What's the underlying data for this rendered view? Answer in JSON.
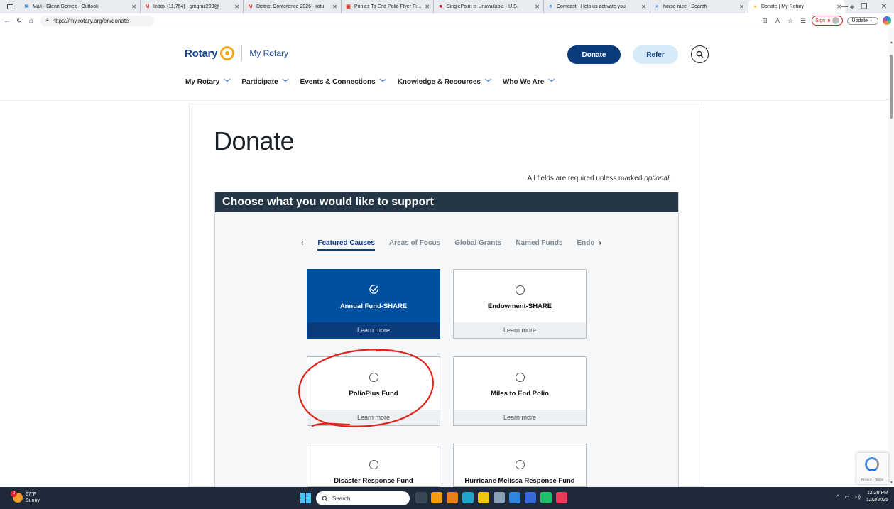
{
  "browser": {
    "tabs": [
      {
        "title": "Mail - Glenn Gomez - Outlook",
        "color": "#0f6cbd",
        "glyph": "✉"
      },
      {
        "title": "Inbox (11,764) - gmgmz209@",
        "color": "#ea4335",
        "glyph": "M"
      },
      {
        "title": "District Conference 2026 - rotu",
        "color": "#ea4335",
        "glyph": "M"
      },
      {
        "title": "Ponies To End Polio Flyer Final",
        "color": "#d93025",
        "glyph": "▣"
      },
      {
        "title": "SinglePoint is Unavailable - U.S.",
        "color": "#c8102e",
        "glyph": "■"
      },
      {
        "title": "Comcast - Help us activate you",
        "color": "#1a73e8",
        "glyph": "e"
      },
      {
        "title": "horse race - Search",
        "color": "#1a73e8",
        "glyph": "⌕"
      },
      {
        "title": "Donate | My Rotary",
        "color": "#f7a81b",
        "glyph": "●"
      }
    ],
    "active_tab_index": 7,
    "url": "https://my.rotary.org/en/donate",
    "sign_in_label": "Sign in",
    "update_label": "Update"
  },
  "site": {
    "logo_word": "Rotary",
    "logo_sub": "My Rotary",
    "donate_button": "Donate",
    "refer_button": "Refer",
    "nav": [
      "My Rotary",
      "Participate",
      "Events & Connections",
      "Knowledge & Resources",
      "Who We Are"
    ]
  },
  "page": {
    "title": "Donate",
    "required_note": "All fields are required unless marked",
    "required_optional": "optional",
    "required_period": ".",
    "support_heading": "Choose what you would like to support",
    "tabs": [
      "Featured Causes",
      "Areas of Focus",
      "Global Grants",
      "Named Funds",
      "Endo"
    ],
    "active_tab": "Featured Causes",
    "options": [
      {
        "name": "Annual Fund-SHARE",
        "learn": "Learn more",
        "selected": true
      },
      {
        "name": "Endowment-SHARE",
        "learn": "Learn more",
        "selected": false
      },
      {
        "name": "PolioPlus Fund",
        "learn": "Learn more",
        "selected": false
      },
      {
        "name": "Miles to End Polio",
        "learn": "Learn more",
        "selected": false
      },
      {
        "name": "Disaster Response Fund",
        "learn": "",
        "selected": false
      },
      {
        "name": "Hurricane Melissa Response Fund",
        "learn": "",
        "selected": false
      }
    ],
    "accent_color": "#0050a2",
    "heading_bar_color": "#253746",
    "annotation_color": "#e0231b"
  },
  "recaptcha": {
    "text": "Privacy - Terms"
  },
  "taskbar": {
    "weather_temp": "67°F",
    "weather_desc": "Sunny",
    "weather_badge": "2",
    "search_placeholder": "Search",
    "time": "12:20 PM",
    "date": "12/2/2025"
  }
}
